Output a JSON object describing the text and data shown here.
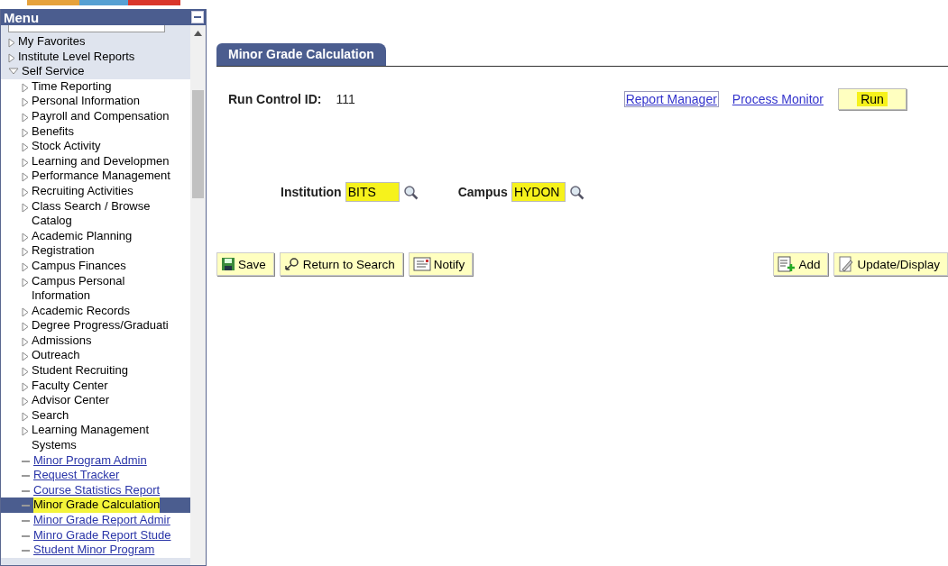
{
  "menu": {
    "title": "Menu",
    "items": [
      {
        "label": "My Favorites",
        "kind": "folder",
        "expanded": false,
        "selected": false
      },
      {
        "label": "Institute Level Reports",
        "kind": "folder",
        "expanded": false,
        "selected": false
      },
      {
        "label": "Self Service",
        "kind": "folder",
        "expanded": true,
        "selected": false,
        "children": [
          {
            "label": "Time Reporting",
            "kind": "folder",
            "expanded": false,
            "selected": false
          },
          {
            "label": "Personal Information",
            "kind": "folder",
            "expanded": false,
            "selected": false
          },
          {
            "label": "Payroll and Compensation",
            "kind": "folder",
            "expanded": false,
            "selected": false
          },
          {
            "label": "Benefits",
            "kind": "folder",
            "expanded": false,
            "selected": false
          },
          {
            "label": "Stock Activity",
            "kind": "folder",
            "expanded": false,
            "selected": false
          },
          {
            "label": "Learning and Developmen",
            "kind": "folder",
            "expanded": false,
            "selected": false
          },
          {
            "label": "Performance Management",
            "kind": "folder",
            "expanded": false,
            "selected": false
          },
          {
            "label": "Recruiting Activities",
            "kind": "folder",
            "expanded": false,
            "selected": false
          },
          {
            "label": "Class Search / Browse Catalog",
            "kind": "folder",
            "expanded": false,
            "selected": false
          },
          {
            "label": "Academic Planning",
            "kind": "folder",
            "expanded": false,
            "selected": false
          },
          {
            "label": "Registration",
            "kind": "folder",
            "expanded": false,
            "selected": false
          },
          {
            "label": "Campus Finances",
            "kind": "folder",
            "expanded": false,
            "selected": false
          },
          {
            "label": "Campus Personal Information",
            "kind": "folder",
            "expanded": false,
            "selected": false
          },
          {
            "label": "Academic Records",
            "kind": "folder",
            "expanded": false,
            "selected": false
          },
          {
            "label": "Degree Progress/Graduati",
            "kind": "folder",
            "expanded": false,
            "selected": false
          },
          {
            "label": "Admissions",
            "kind": "folder",
            "expanded": false,
            "selected": false
          },
          {
            "label": "Outreach",
            "kind": "folder",
            "expanded": false,
            "selected": false
          },
          {
            "label": "Student Recruiting",
            "kind": "folder",
            "expanded": false,
            "selected": false
          },
          {
            "label": "Faculty Center",
            "kind": "folder",
            "expanded": false,
            "selected": false
          },
          {
            "label": "Advisor Center",
            "kind": "folder",
            "expanded": false,
            "selected": false
          },
          {
            "label": "Search",
            "kind": "folder",
            "expanded": false,
            "selected": false
          },
          {
            "label": "Learning Management Systems",
            "kind": "folder",
            "expanded": false,
            "selected": false
          },
          {
            "label": "Minor Program Admin",
            "kind": "link",
            "selected": false
          },
          {
            "label": "Request Tracker",
            "kind": "link",
            "selected": false
          },
          {
            "label": "Course Statistics Report",
            "kind": "link",
            "selected": false
          },
          {
            "label": "Minor Grade Calculation",
            "kind": "link",
            "selected": true
          },
          {
            "label": "Minor Grade Report Admir",
            "kind": "link",
            "selected": false
          },
          {
            "label": "Minro Grade Report Stude",
            "kind": "link",
            "selected": false
          },
          {
            "label": "Student Minor Program",
            "kind": "link",
            "selected": false
          }
        ]
      }
    ]
  },
  "page_tab": {
    "label": "Minor Grade Calculation",
    "selected": true
  },
  "run_control": {
    "label": "Run Control ID:",
    "value": "111"
  },
  "links": [
    "Report Manager",
    "Process Monitor"
  ],
  "run_button": {
    "label": "Run",
    "highlighted": true
  },
  "fields": [
    {
      "label": "Institution",
      "value": "BITS",
      "highlighted": true
    },
    {
      "label": "Campus",
      "value": "HYDON",
      "highlighted": true
    }
  ],
  "toolbar_left": [
    {
      "label": "Save"
    },
    {
      "label": "Return to Search"
    },
    {
      "label": "Notify"
    }
  ],
  "toolbar_right": [
    {
      "label": "Add"
    },
    {
      "label": "Update/Display"
    }
  ]
}
